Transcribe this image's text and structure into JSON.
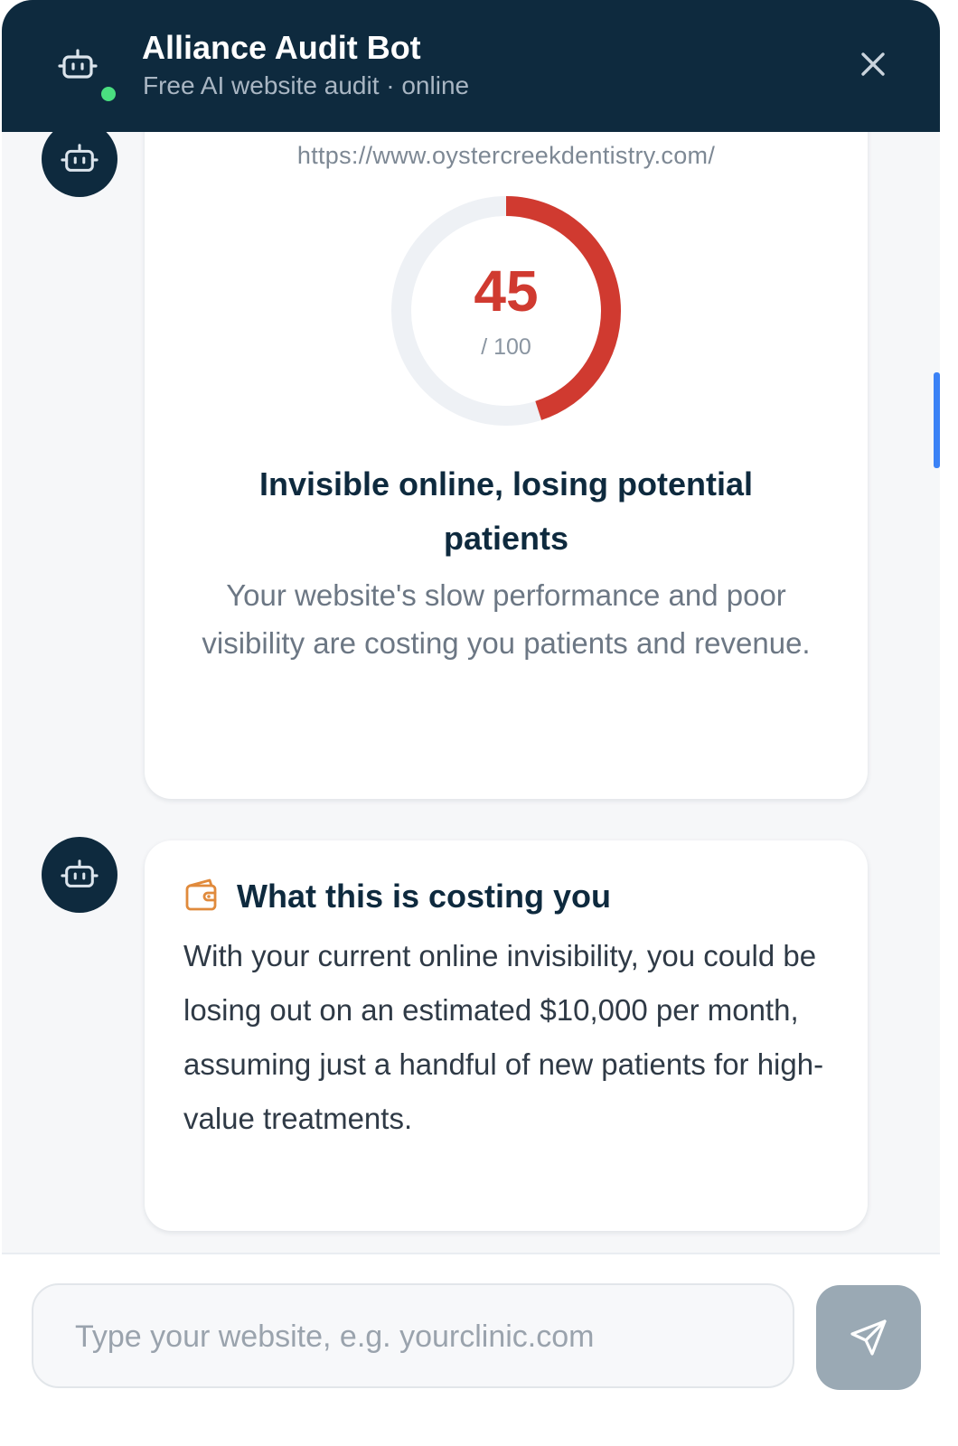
{
  "header": {
    "title": "Alliance Audit Bot",
    "subtitle": "Free AI website audit · online",
    "status": "online",
    "status_color": "#4ade80",
    "bot_icon": "robot-icon",
    "close_icon": "close-icon",
    "background": "#0e2a3e"
  },
  "audit": {
    "url": "https://www.oystercreekdentistry.com/",
    "score": "45",
    "score_max": "/ 100",
    "score_fraction": 0.45,
    "score_color": "#d03a30",
    "headline": "Invisible online, losing potential patients",
    "description": "Your website's slow performance and poor visibility are costing you patients and revenue."
  },
  "cost": {
    "icon": "wallet-icon",
    "icon_color": "#e08a3c",
    "title": "What this is costing you",
    "body": "With your current online invisibility, you could be losing out on an estimated $10,000 per month, assuming just a handful of new patients for high-value treatments."
  },
  "composer": {
    "placeholder": "Type your website, e.g. yourclinic.com",
    "send_icon": "send-icon"
  }
}
